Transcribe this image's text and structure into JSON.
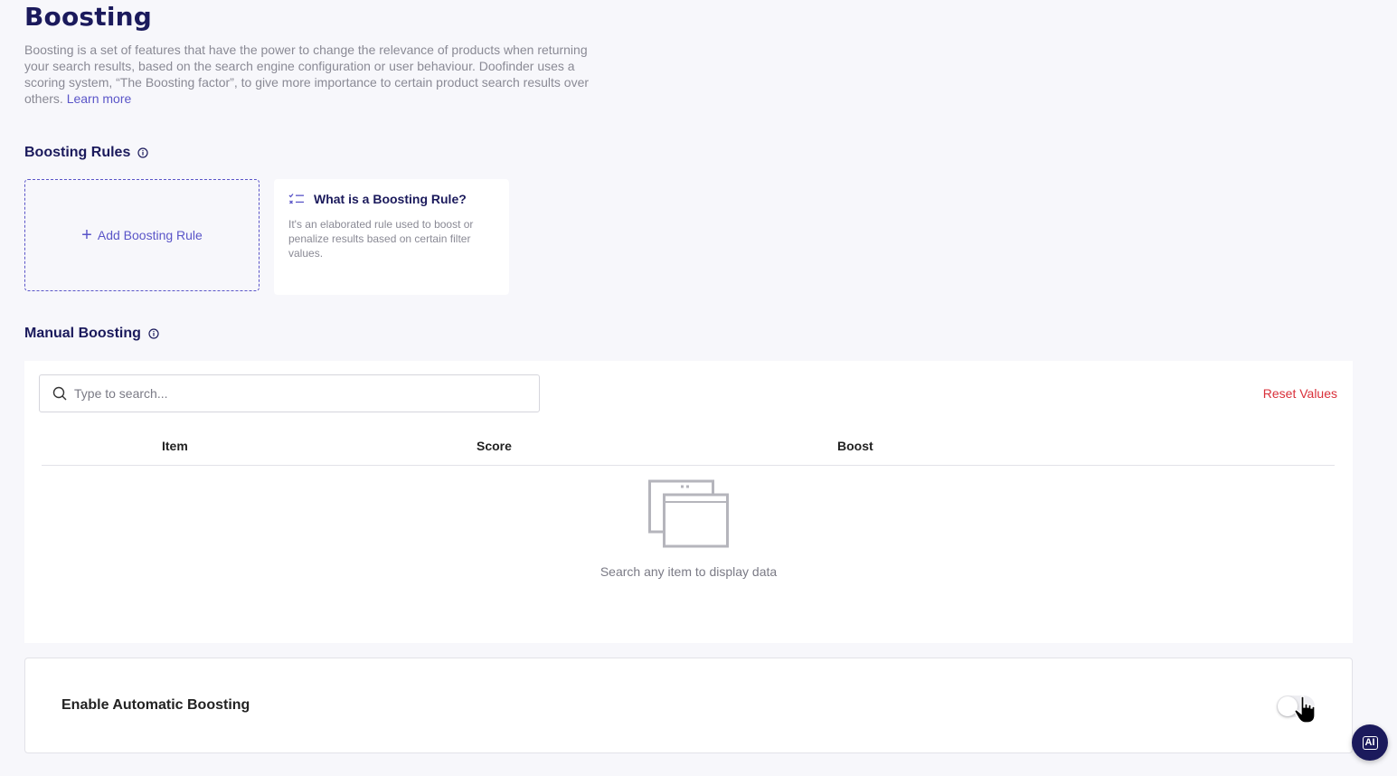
{
  "header": {
    "title": "Boosting",
    "intro_text": "Boosting is a set of features that have the power to change the relevance of products when returning your search results, based on the search engine configuration or user behaviour. Doofinder uses a scoring system, “The Boosting factor”, to give more importance to certain product search results over others.",
    "learn_more": "Learn more"
  },
  "boosting_rules": {
    "title": "Boosting Rules",
    "add_label": "Add Boosting Rule",
    "info_card": {
      "title": "What is a Boosting Rule?",
      "description": "It's an elaborated rule used to boost or penalize results based on certain filter values."
    }
  },
  "manual_boosting": {
    "title": "Manual Boosting",
    "search_placeholder": "Type to search...",
    "reset_label": "Reset Values",
    "columns": [
      "Item",
      "Score",
      "Boost"
    ],
    "empty_text": "Search any item to display data"
  },
  "automatic_boosting": {
    "label": "Enable Automatic Boosting",
    "enabled": false
  },
  "ai_button": {
    "label": "AI"
  },
  "colors": {
    "brand": "#1b1a5c",
    "accent": "#5a55c8",
    "danger": "#d9303a"
  }
}
